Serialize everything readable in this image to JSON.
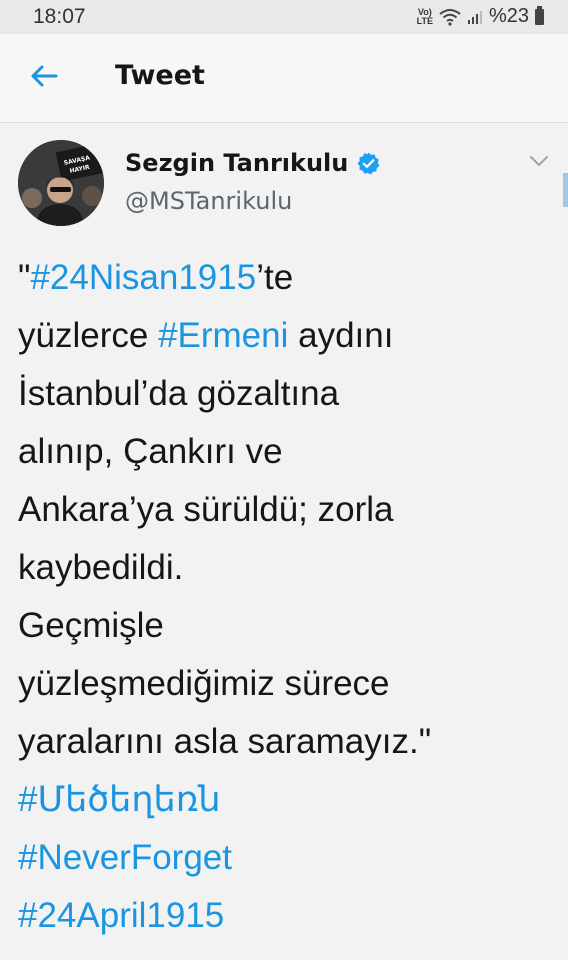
{
  "status_bar": {
    "time": "18:07",
    "network": "Vo) LTE",
    "battery_text": "%23"
  },
  "header": {
    "title": "Tweet"
  },
  "tweet": {
    "author_name": "Sezgin Tanrıkulu",
    "author_handle": "@MSTanrikulu",
    "avatar_sign_text": "SAVAŞA HAYIR",
    "lines": {
      "l1_pre": "\"",
      "l1_tag": "#24Nisan1915",
      "l1_post": "’te",
      "l2_pre": "yüzlerce ",
      "l2_tag": "#Ermeni",
      "l2_post": " aydını",
      "l3": "İstanbul’da gözaltına",
      "l4": "alınıp, Çankırı ve",
      "l5": "Ankara’ya sürüldü; zorla",
      "l6": "kaybedildi.",
      "l7": "Geçmişle",
      "l8": "yüzleşmediğimiz sürece",
      "l9": "yaralarını asla saramayız.\"",
      "tag_armenian": "#Մեծեղեռն",
      "tag_neverforget": "#NeverForget",
      "tag_april": "#24April1915"
    }
  },
  "colors": {
    "link": "#1b95e0",
    "verified": "#1da1f2"
  },
  "icons": [
    "back-arrow-icon",
    "verified-badge-icon",
    "chevron-down-icon",
    "wifi-icon",
    "signal-icon",
    "battery-icon"
  ]
}
